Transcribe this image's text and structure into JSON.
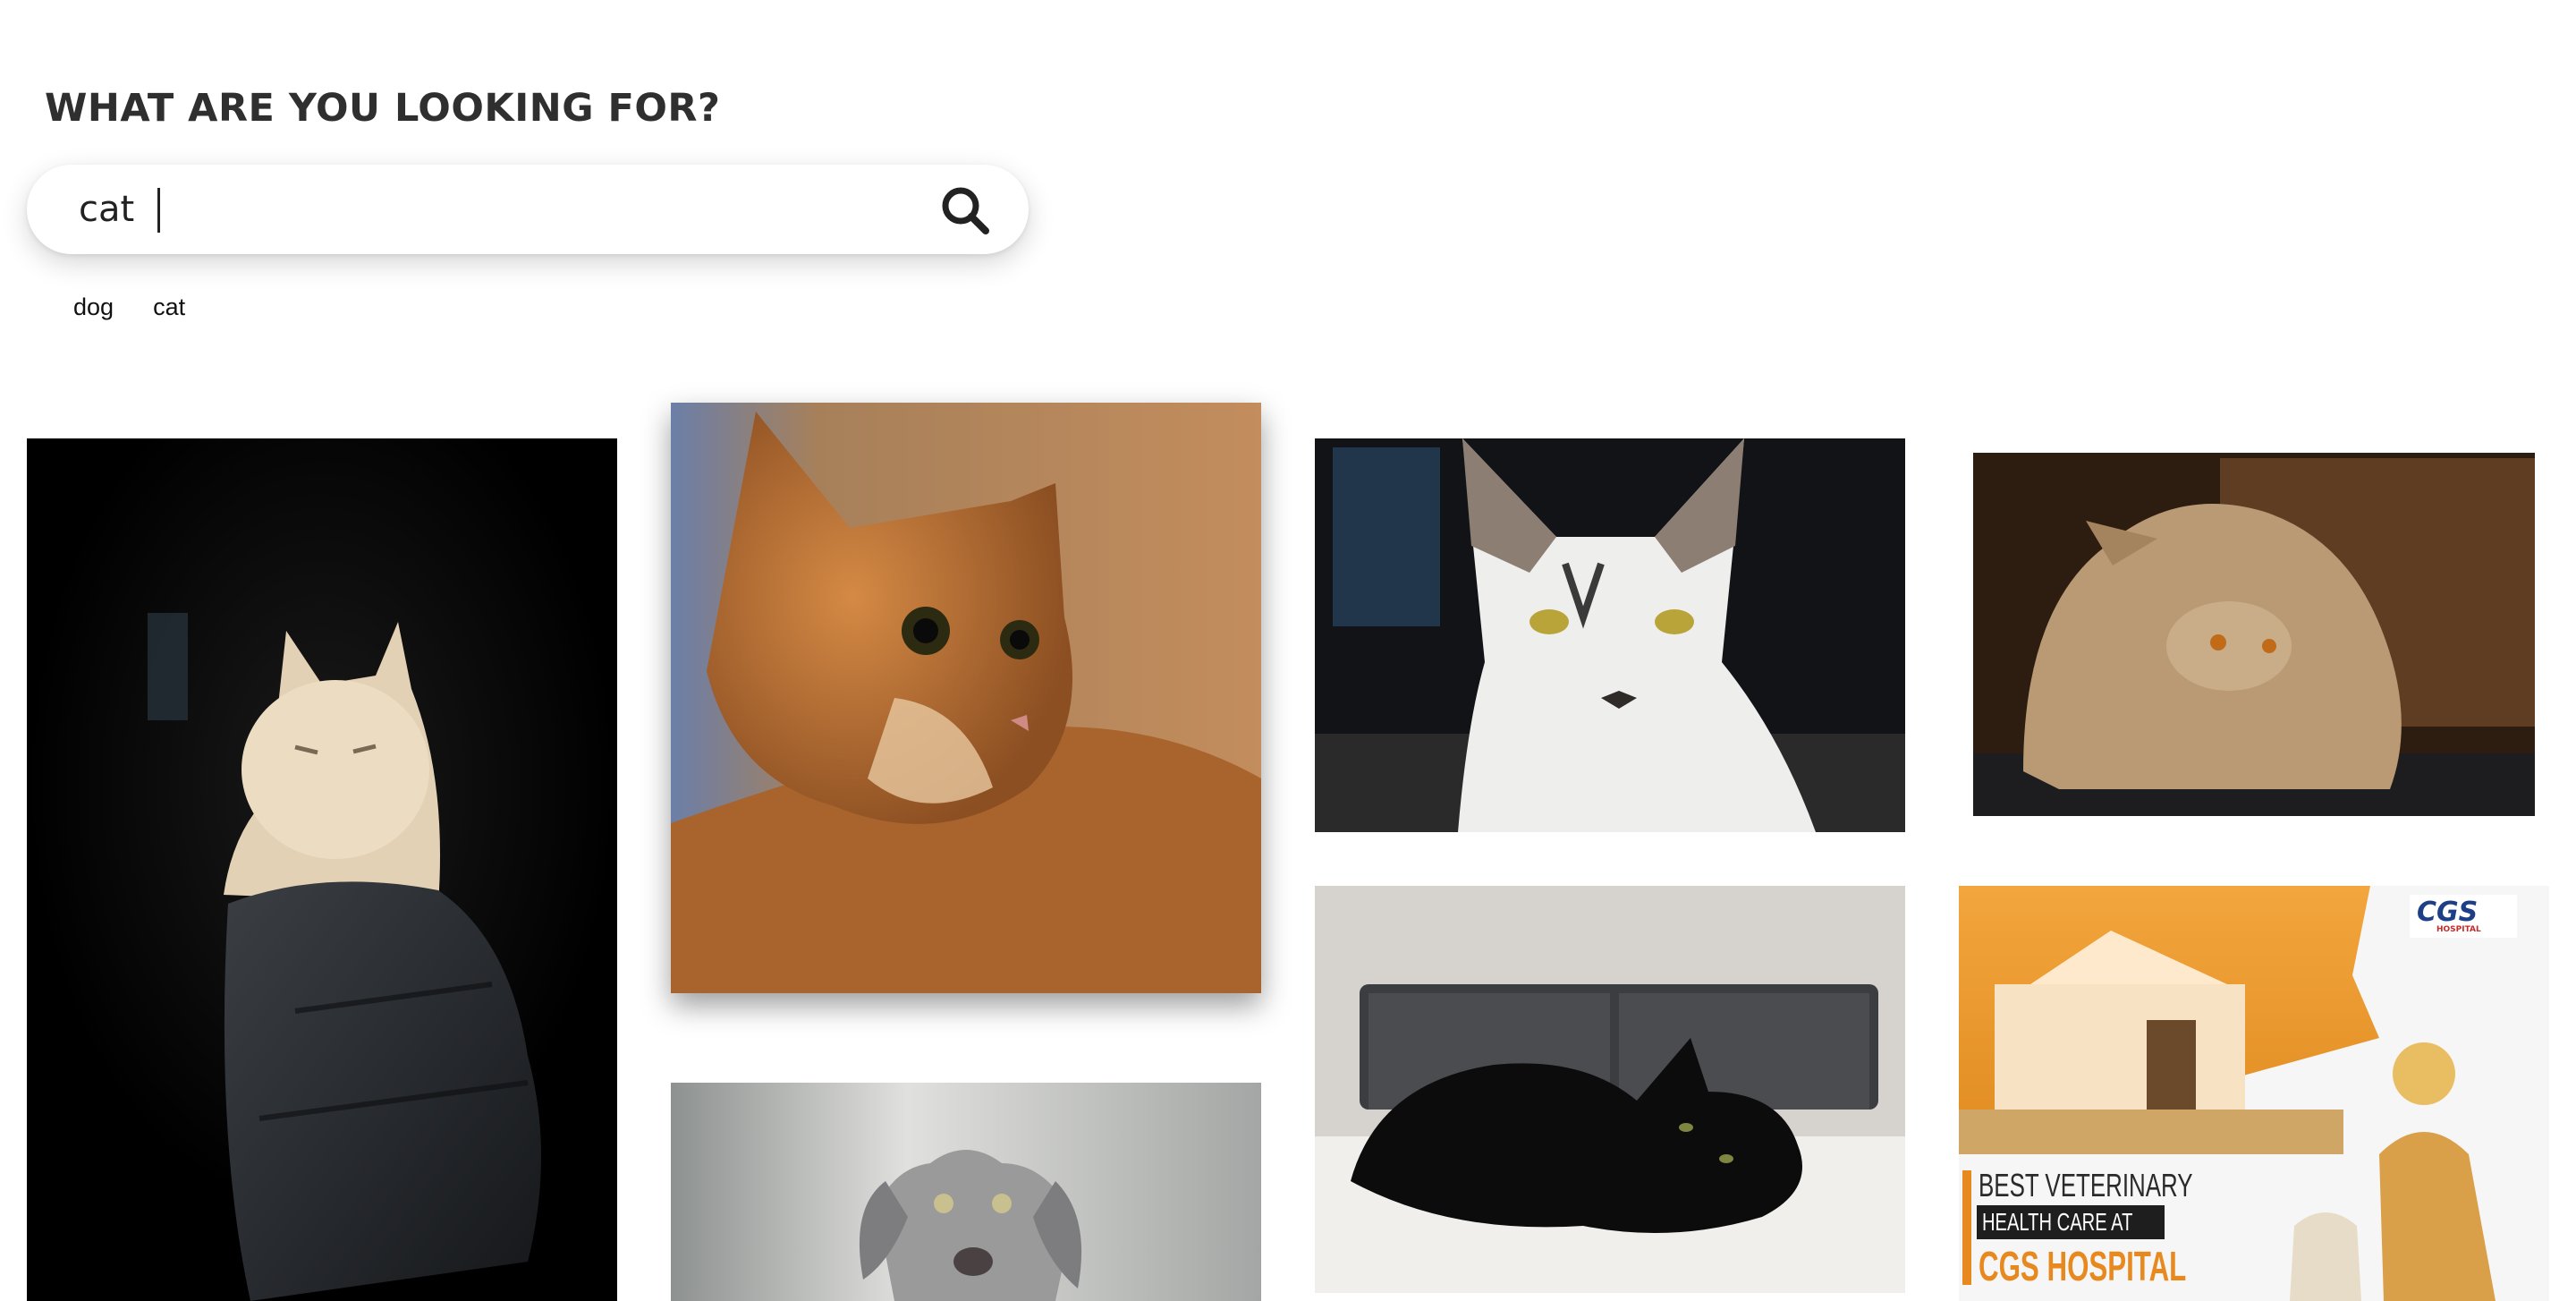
{
  "search": {
    "heading": "WHAT ARE YOU LOOKING FOR?",
    "query": "cat",
    "button_icon": "search-icon"
  },
  "suggestions": [
    "dog",
    "cat"
  ],
  "gallery": {
    "items": [
      {
        "subject": "cream cat on dark rock"
      },
      {
        "subject": "orange long-haired cat"
      },
      {
        "subject": "white and tabby cat"
      },
      {
        "subject": "fluffy persian cat"
      },
      {
        "subject": "weimaraner dog"
      },
      {
        "subject": "black cat on bed"
      },
      {
        "subject": "CGS hospital veterinary ad"
      }
    ],
    "ad": {
      "logo": "CGS",
      "logo_sub": "HOSPITAL",
      "line1": "BEST VETERINARY",
      "line2": "HEALTH CARE AT",
      "line3": "CGS HOSPITAL"
    }
  }
}
